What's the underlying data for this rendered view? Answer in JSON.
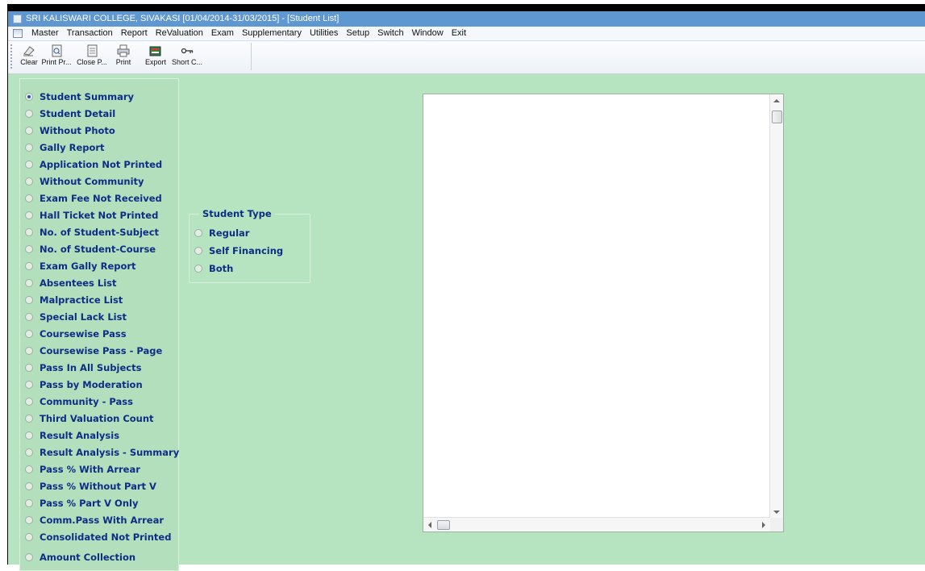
{
  "window": {
    "title": "SRI KALISWARI COLLEGE, SIVAKASI [01/04/2014-31/03/2015] - [Student List]"
  },
  "menu": {
    "items": [
      "Master",
      "Transaction",
      "Report",
      "ReValuation",
      "Exam",
      "Supplementary",
      "Utilities",
      "Setup",
      "Switch",
      "Window",
      "Exit"
    ]
  },
  "toolbar": {
    "clear": "Clear",
    "print_preview": "Print Pr...",
    "close_preview": "Close P...",
    "print": "Print",
    "export": "Export",
    "shortcut": "Short C..."
  },
  "report_options": {
    "selected_index": 0,
    "items": [
      "Student Summary",
      "Student Detail",
      "Without Photo",
      "Gally Report",
      "Application Not Printed",
      "Without Community",
      "Exam Fee Not Received",
      "Hall Ticket Not Printed",
      "No. of Student-Subject",
      "No. of Student-Course",
      "Exam Gally Report",
      "Absentees List",
      "Malpractice List",
      "Special Lack List",
      "Coursewise Pass",
      "Coursewise Pass - Page",
      "Pass In All Subjects",
      "Pass by Moderation",
      "Community - Pass",
      "Third Valuation Count",
      "Result Analysis",
      "Result Analysis - Summary",
      "Pass % With Arrear",
      "Pass % Without Part V",
      "Pass %  Part V Only",
      "Comm.Pass With Arrear",
      "Consolidated Not Printed",
      "Amount Collection"
    ]
  },
  "student_type": {
    "legend": "Student Type",
    "options": [
      "Regular",
      "Self Financing",
      "Both"
    ]
  },
  "colors": {
    "titlebar": "#5f97d0",
    "background": "#b6e3c0",
    "option_text": "#0e2e86"
  }
}
